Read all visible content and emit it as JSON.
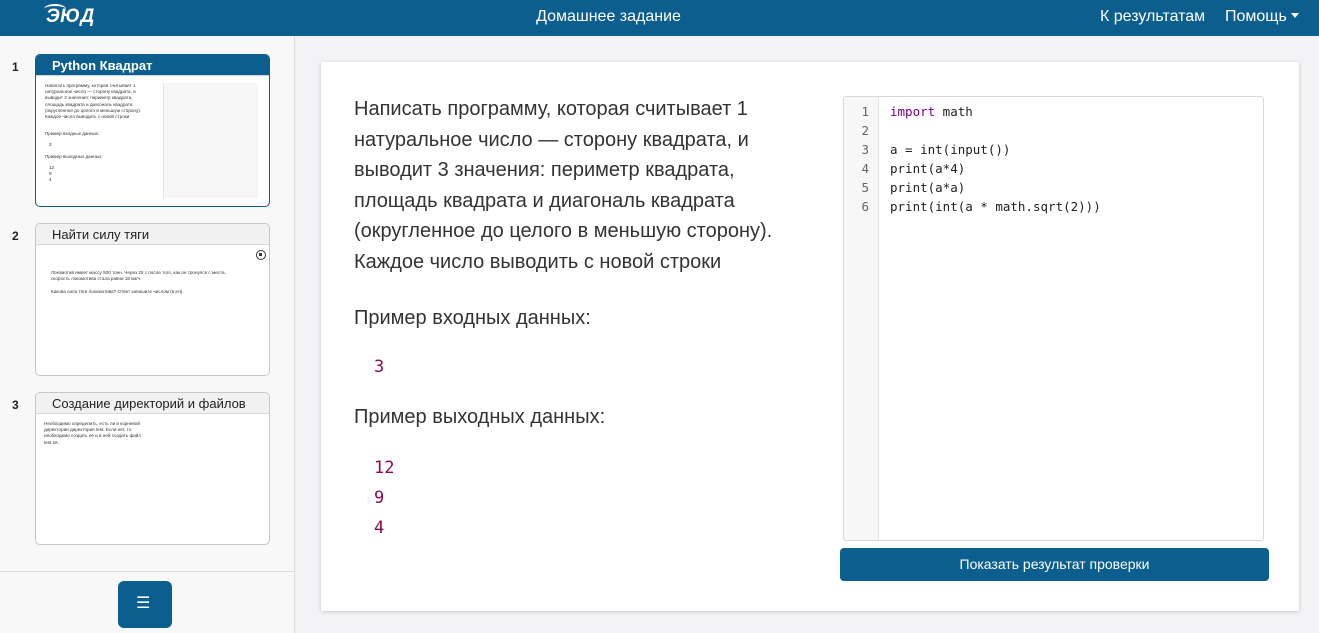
{
  "topbar": {
    "logo": "ЭЮД",
    "title": "Домашнее задание",
    "results_link": "К результатам",
    "help_menu": "Помощь"
  },
  "sidebar": {
    "tasks": [
      {
        "number": "1",
        "title": "Python Квадрат",
        "preview_text": "Написать программу, которая считывает 1\nнатуральное число — сторону квадрата, и\nвыводит 3 значения: периметр квадрата,\nплощадь квадрата и диагональ квадрата\n(округленное до целого в меньшую сторону).\nКаждое число выводить с новой строки",
        "preview_input_label": "Пример входных данных:",
        "preview_input": "3",
        "preview_output_label": "Пример выходных данных:",
        "preview_output": "12\n9\n4"
      },
      {
        "number": "2",
        "title": "Найти силу тяги",
        "preview_text": "Локомотив имеет массу 500 тонн. Через 25 с после того, как он тронулся с места,\nскорость локомотива стала равна 18 км/ч.\n\nКакова сила тяги локомотива? Ответ запишите числом (в кН)."
      },
      {
        "number": "3",
        "title": "Создание директорий и файлов",
        "preview_text": "Необходимо определить, есть ли в корневой\nдиректории директория test. Если нет, то\nнеобходимо создать её и в ней создать файл\ntest.txt."
      }
    ],
    "list_button_icon": "list-icon"
  },
  "task": {
    "description": "Написать программу, которая считывает 1 натуральное число — сторону квадрата, и выводит 3 значения: периметр квадрата, площадь квадрата и диагональ квадрата (округленное до целого в меньшую сторону). Каждое число выводить с новой строки",
    "input_label": "Пример входных данных:",
    "input_values": [
      "3"
    ],
    "output_label": "Пример выходных данных:",
    "output_values": [
      "12",
      "9",
      "4"
    ]
  },
  "editor": {
    "line_numbers": [
      "1",
      "2",
      "3",
      "4",
      "5",
      "6"
    ],
    "lines": [
      {
        "kw": "import",
        "rest": " math"
      },
      {
        "kw": "",
        "rest": ""
      },
      {
        "kw": "",
        "rest": "a = int(input())"
      },
      {
        "kw": "",
        "rest": "print(a*4)"
      },
      {
        "kw": "",
        "rest": "print(a*a)"
      },
      {
        "kw": "",
        "rest": "print(int(a * math.sqrt(2)))"
      }
    ],
    "check_button": "Показать результат проверки"
  },
  "colors": {
    "brand": "#0b5e8e",
    "io_text": "#8b0a50",
    "keyword": "#770088"
  }
}
